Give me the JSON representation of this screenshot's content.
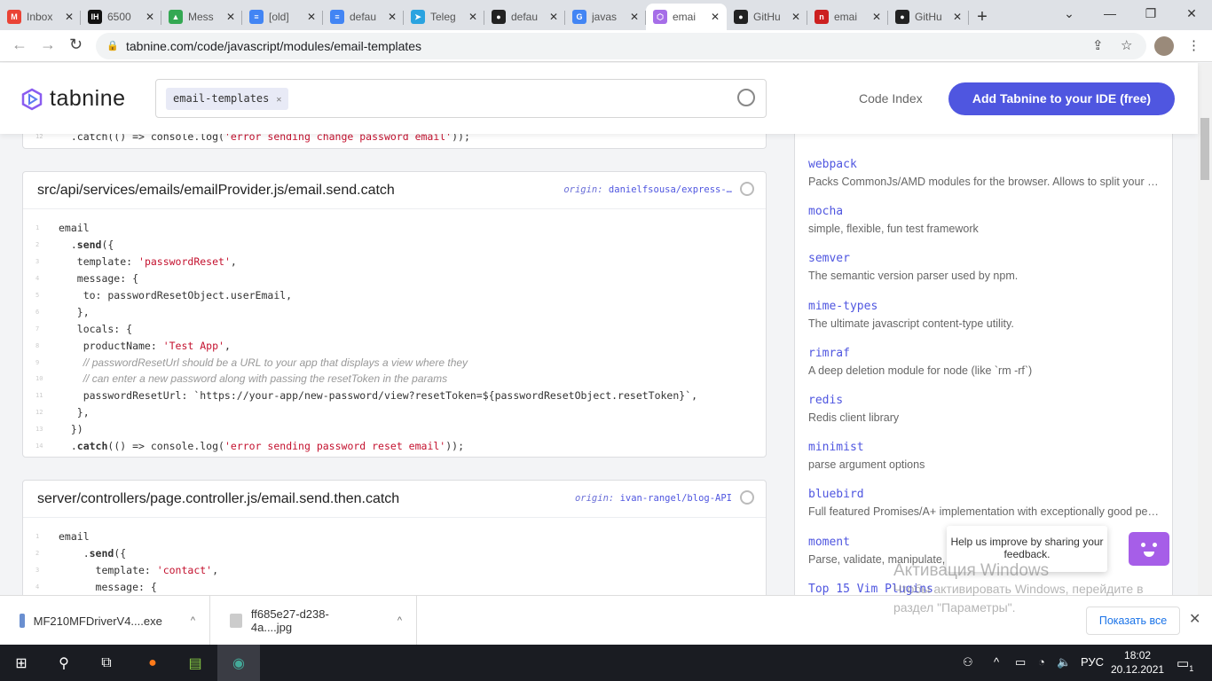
{
  "browser": {
    "tabs": [
      {
        "title": "Inbox",
        "color": "#ea4335",
        "glyph": "M"
      },
      {
        "title": "6500",
        "color": "#111",
        "glyph": "IH"
      },
      {
        "title": "Mess",
        "color": "#34a853",
        "glyph": "▲"
      },
      {
        "title": "[old]",
        "color": "#4285f4",
        "glyph": "≡"
      },
      {
        "title": "defau",
        "color": "#4285f4",
        "glyph": "≡"
      },
      {
        "title": "Teleg",
        "color": "#2aa3e0",
        "glyph": "➤"
      },
      {
        "title": "defau",
        "color": "#222",
        "glyph": "●"
      },
      {
        "title": "javas",
        "color": "#4285f4",
        "glyph": "G"
      },
      {
        "title": "emai",
        "color": "#a66ee8",
        "glyph": "⬡",
        "active": true
      },
      {
        "title": "GitHu",
        "color": "#222",
        "glyph": "●"
      },
      {
        "title": "emai",
        "color": "#cc1f1f",
        "glyph": "n"
      },
      {
        "title": "GitHu",
        "color": "#222",
        "glyph": "●"
      }
    ],
    "url": "tabnine.com/code/javascript/modules/email-templates"
  },
  "header": {
    "logo": "tabnine",
    "search_chip": "email-templates",
    "code_index": "Code Index",
    "cta": "Add Tabnine to your IDE (free)"
  },
  "cards": [
    {
      "lines": [
        {
          "n": "12",
          "seg": [
            [
              "  .catch(() => console.log(",
              ""
            ],
            [
              "'error sending change password email'",
              "s"
            ],
            [
              "));",
              ""
            ]
          ]
        }
      ]
    },
    {
      "path": "src/api/services/emails/emailProvider.js/email.send.catch",
      "origin_label": "origin:",
      "origin": "danielfsousa/express-…",
      "lines": [
        {
          "n": "1",
          "seg": [
            [
              "email",
              ""
            ]
          ]
        },
        {
          "n": "2",
          "seg": [
            [
              "  .",
              ""
            ],
            [
              "send",
              "k"
            ],
            [
              "({",
              ""
            ]
          ]
        },
        {
          "n": "3",
          "seg": [
            [
              "   template: ",
              ""
            ],
            [
              "'passwordReset'",
              "s"
            ],
            [
              ",",
              ""
            ]
          ]
        },
        {
          "n": "4",
          "seg": [
            [
              "   message: {",
              ""
            ]
          ]
        },
        {
          "n": "5",
          "seg": [
            [
              "    to: passwordResetObject.userEmail,",
              ""
            ]
          ]
        },
        {
          "n": "6",
          "seg": [
            [
              "   },",
              ""
            ]
          ]
        },
        {
          "n": "7",
          "seg": [
            [
              "   locals: {",
              ""
            ]
          ]
        },
        {
          "n": "8",
          "seg": [
            [
              "    productName: ",
              ""
            ],
            [
              "'Test App'",
              "s"
            ],
            [
              ",",
              ""
            ]
          ]
        },
        {
          "n": "9",
          "seg": [
            [
              "    ",
              ""
            ],
            [
              "// passwordResetUrl should be a URL to your app that displays a view where they",
              "c"
            ]
          ]
        },
        {
          "n": "10",
          "seg": [
            [
              "    ",
              ""
            ],
            [
              "// can enter a new password along with passing the resetToken in the params",
              "c"
            ]
          ]
        },
        {
          "n": "11",
          "seg": [
            [
              "    passwordResetUrl: `https://your-app/new-password/view?resetToken=${passwordResetObject.resetToken}`,",
              ""
            ]
          ]
        },
        {
          "n": "12",
          "seg": [
            [
              "   },",
              ""
            ]
          ]
        },
        {
          "n": "13",
          "seg": [
            [
              "  })",
              ""
            ]
          ]
        },
        {
          "n": "14",
          "seg": [
            [
              "  .",
              ""
            ],
            [
              "catch",
              "k"
            ],
            [
              "(() => console.log(",
              ""
            ],
            [
              "'error sending password reset email'",
              "s"
            ],
            [
              "));",
              ""
            ]
          ]
        }
      ]
    },
    {
      "path": "server/controllers/page.controller.js/email.send.then.catch",
      "origin_label": "origin:",
      "origin": "ivan-rangel/blog-API",
      "lines": [
        {
          "n": "1",
          "seg": [
            [
              "email",
              ""
            ]
          ]
        },
        {
          "n": "2",
          "seg": [
            [
              "    .",
              ""
            ],
            [
              "send",
              "k"
            ],
            [
              "({",
              ""
            ]
          ]
        },
        {
          "n": "3",
          "seg": [
            [
              "      template: ",
              ""
            ],
            [
              "'contact'",
              "s"
            ],
            [
              ",",
              ""
            ]
          ]
        },
        {
          "n": "4",
          "seg": [
            [
              "      message: {",
              ""
            ]
          ]
        }
      ]
    }
  ],
  "sidebar": [
    {
      "name": "webpack",
      "desc": "Packs CommonJs/AMD modules for the browser. Allows to split your codebase into multiple bundles"
    },
    {
      "name": "mocha",
      "desc": "simple, flexible, fun test framework"
    },
    {
      "name": "semver",
      "desc": "The semantic version parser used by npm."
    },
    {
      "name": "mime-types",
      "desc": "The ultimate javascript content-type utility."
    },
    {
      "name": "rimraf",
      "desc": "A deep deletion module for node (like `rm -rf`)"
    },
    {
      "name": "redis",
      "desc": "Redis client library"
    },
    {
      "name": "minimist",
      "desc": "parse argument options"
    },
    {
      "name": "bluebird",
      "desc": "Full featured Promises/A+ implementation with exceptionally good performance"
    },
    {
      "name": "moment",
      "desc": "Parse, validate, manipulate, and display dates"
    },
    {
      "name": "Top 15 Vim Plugins",
      "desc": ""
    }
  ],
  "feedback": {
    "text": "Help us improve by sharing your feedback."
  },
  "watermark": {
    "title": "Активация Windows",
    "body": "Чтобы активировать Windows, перейдите в раздел \"Параметры\"."
  },
  "downloads": {
    "items": [
      "MF210MFDriverV4....exe",
      "ff685e27-d238-4a....jpg"
    ],
    "show_all": "Показать все"
  },
  "taskbar": {
    "lang": "РУС",
    "time": "18:02",
    "date": "20.12.2021",
    "notif": "1"
  }
}
